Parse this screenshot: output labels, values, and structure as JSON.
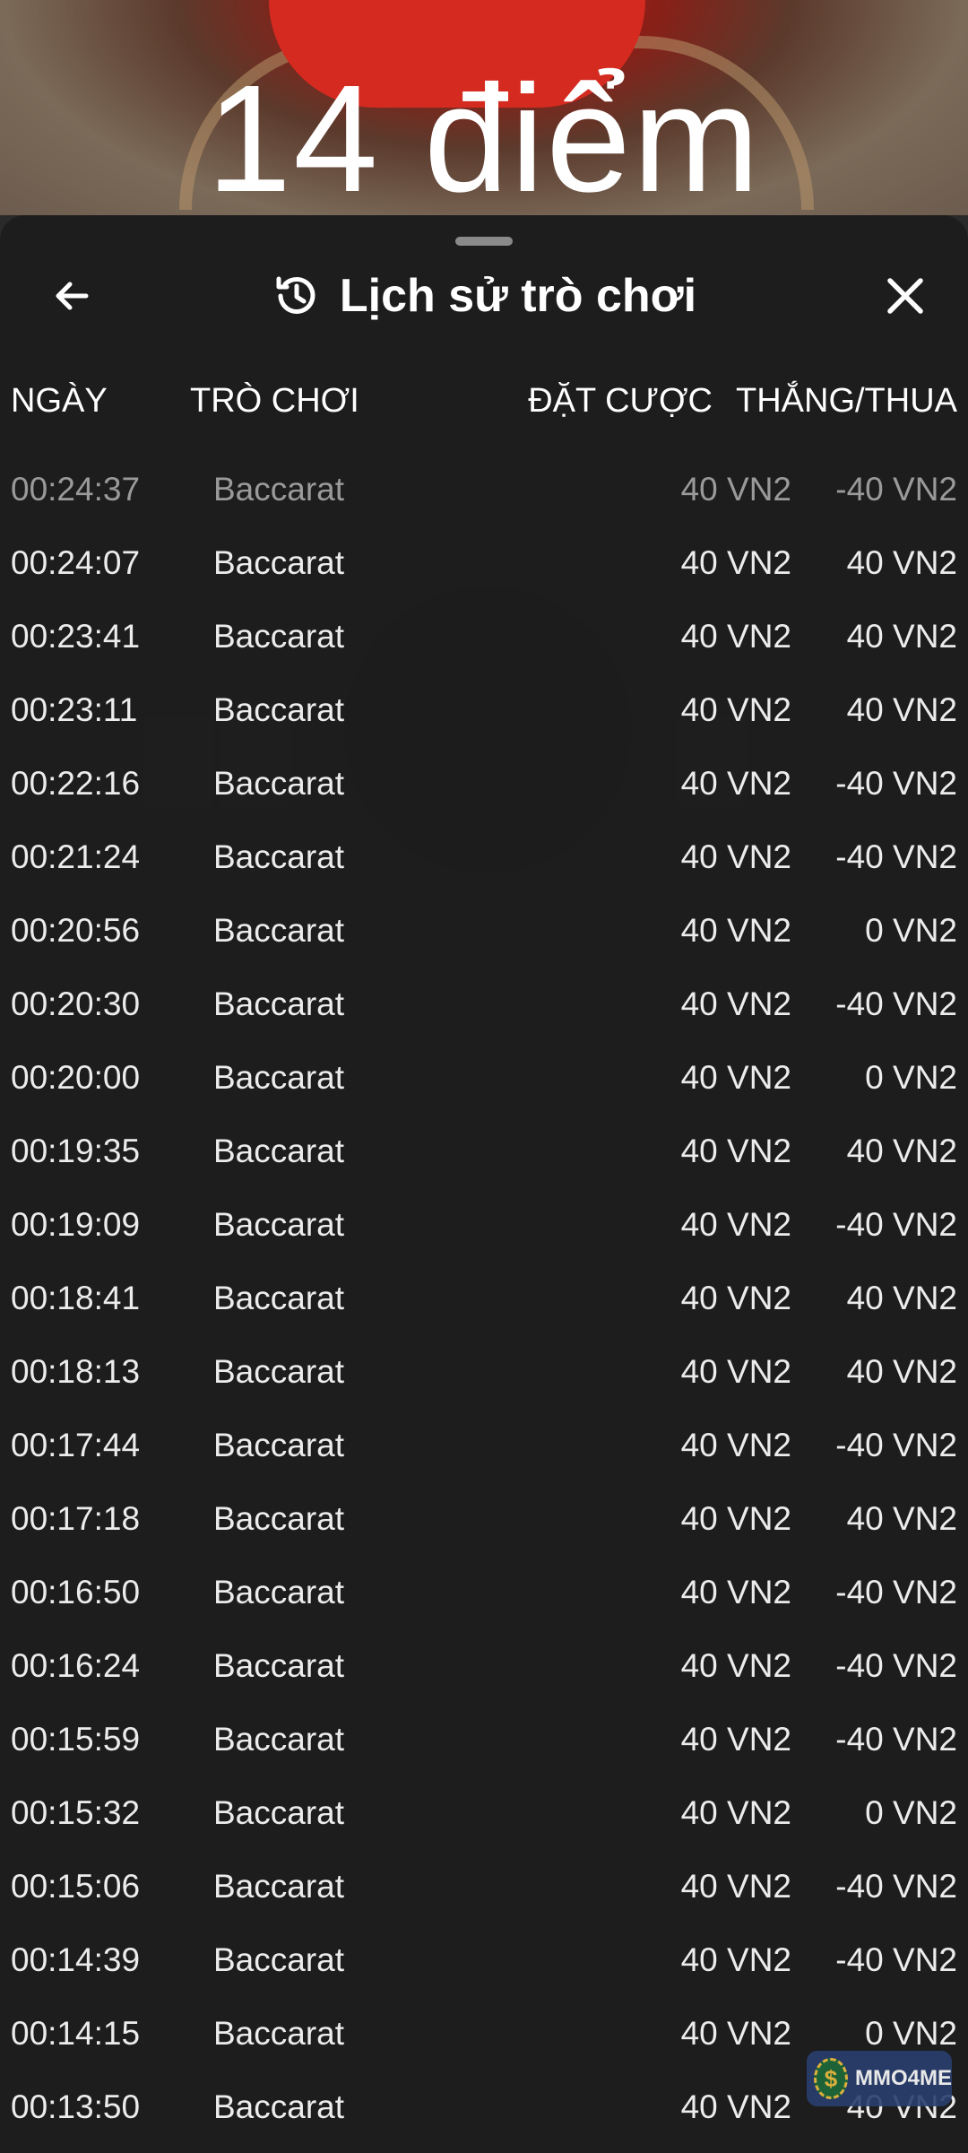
{
  "background": {
    "score_text": "14 điểm"
  },
  "header": {
    "title": "Lịch sử trò chơi"
  },
  "columns": {
    "date": "NGÀY",
    "game": "TRÒ CHƠI",
    "bet": "ĐẶT CƯỢC",
    "win_loss": "THẮNG/THUA"
  },
  "rows": [
    {
      "date": "00:24:37",
      "game": "Baccarat",
      "bet": "40 VN2",
      "win_loss": "-40 VN2"
    },
    {
      "date": "00:24:07",
      "game": "Baccarat",
      "bet": "40 VN2",
      "win_loss": "40 VN2"
    },
    {
      "date": "00:23:41",
      "game": "Baccarat",
      "bet": "40 VN2",
      "win_loss": "40 VN2"
    },
    {
      "date": "00:23:11",
      "game": "Baccarat",
      "bet": "40 VN2",
      "win_loss": "40 VN2"
    },
    {
      "date": "00:22:16",
      "game": "Baccarat",
      "bet": "40 VN2",
      "win_loss": "-40 VN2"
    },
    {
      "date": "00:21:24",
      "game": "Baccarat",
      "bet": "40 VN2",
      "win_loss": "-40 VN2"
    },
    {
      "date": "00:20:56",
      "game": "Baccarat",
      "bet": "40 VN2",
      "win_loss": "0 VN2"
    },
    {
      "date": "00:20:30",
      "game": "Baccarat",
      "bet": "40 VN2",
      "win_loss": "-40 VN2"
    },
    {
      "date": "00:20:00",
      "game": "Baccarat",
      "bet": "40 VN2",
      "win_loss": "0 VN2"
    },
    {
      "date": "00:19:35",
      "game": "Baccarat",
      "bet": "40 VN2",
      "win_loss": "40 VN2"
    },
    {
      "date": "00:19:09",
      "game": "Baccarat",
      "bet": "40 VN2",
      "win_loss": "-40 VN2"
    },
    {
      "date": "00:18:41",
      "game": "Baccarat",
      "bet": "40 VN2",
      "win_loss": "40 VN2"
    },
    {
      "date": "00:18:13",
      "game": "Baccarat",
      "bet": "40 VN2",
      "win_loss": "40 VN2"
    },
    {
      "date": "00:17:44",
      "game": "Baccarat",
      "bet": "40 VN2",
      "win_loss": "-40 VN2"
    },
    {
      "date": "00:17:18",
      "game": "Baccarat",
      "bet": "40 VN2",
      "win_loss": "40 VN2"
    },
    {
      "date": "00:16:50",
      "game": "Baccarat",
      "bet": "40 VN2",
      "win_loss": "-40 VN2"
    },
    {
      "date": "00:16:24",
      "game": "Baccarat",
      "bet": "40 VN2",
      "win_loss": "-40 VN2"
    },
    {
      "date": "00:15:59",
      "game": "Baccarat",
      "bet": "40 VN2",
      "win_loss": "-40 VN2"
    },
    {
      "date": "00:15:32",
      "game": "Baccarat",
      "bet": "40 VN2",
      "win_loss": "0 VN2"
    },
    {
      "date": "00:15:06",
      "game": "Baccarat",
      "bet": "40 VN2",
      "win_loss": "-40 VN2"
    },
    {
      "date": "00:14:39",
      "game": "Baccarat",
      "bet": "40 VN2",
      "win_loss": "-40 VN2"
    },
    {
      "date": "00:14:15",
      "game": "Baccarat",
      "bet": "40 VN2",
      "win_loss": "0 VN2"
    },
    {
      "date": "00:13:50",
      "game": "Baccarat",
      "bet": "40 VN2",
      "win_loss": "40 VN2"
    }
  ],
  "watermark": {
    "text": "MMO4ME"
  },
  "icons": {
    "back": "arrow-left-icon",
    "history": "history-clock-icon",
    "close": "close-icon"
  }
}
